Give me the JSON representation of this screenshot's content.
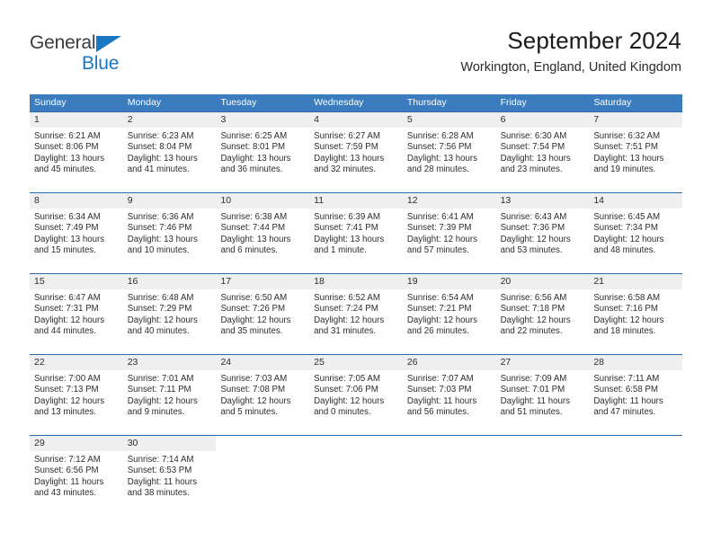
{
  "brand": {
    "name_part1": "General",
    "name_part2": "Blue",
    "accent_color": "#1878c4",
    "text_color": "#3b3b3b"
  },
  "header": {
    "title": "September 2024",
    "subtitle": "Workington, England, United Kingdom"
  },
  "calendar": {
    "header_bg": "#3a7cbe",
    "row_border": "#2d6ca8",
    "daynum_bg": "#efefef",
    "weekdays": [
      "Sunday",
      "Monday",
      "Tuesday",
      "Wednesday",
      "Thursday",
      "Friday",
      "Saturday"
    ],
    "weeks": [
      [
        {
          "day": "1",
          "sunrise": "Sunrise: 6:21 AM",
          "sunset": "Sunset: 8:06 PM",
          "daylight1": "Daylight: 13 hours",
          "daylight2": "and 45 minutes."
        },
        {
          "day": "2",
          "sunrise": "Sunrise: 6:23 AM",
          "sunset": "Sunset: 8:04 PM",
          "daylight1": "Daylight: 13 hours",
          "daylight2": "and 41 minutes."
        },
        {
          "day": "3",
          "sunrise": "Sunrise: 6:25 AM",
          "sunset": "Sunset: 8:01 PM",
          "daylight1": "Daylight: 13 hours",
          "daylight2": "and 36 minutes."
        },
        {
          "day": "4",
          "sunrise": "Sunrise: 6:27 AM",
          "sunset": "Sunset: 7:59 PM",
          "daylight1": "Daylight: 13 hours",
          "daylight2": "and 32 minutes."
        },
        {
          "day": "5",
          "sunrise": "Sunrise: 6:28 AM",
          "sunset": "Sunset: 7:56 PM",
          "daylight1": "Daylight: 13 hours",
          "daylight2": "and 28 minutes."
        },
        {
          "day": "6",
          "sunrise": "Sunrise: 6:30 AM",
          "sunset": "Sunset: 7:54 PM",
          "daylight1": "Daylight: 13 hours",
          "daylight2": "and 23 minutes."
        },
        {
          "day": "7",
          "sunrise": "Sunrise: 6:32 AM",
          "sunset": "Sunset: 7:51 PM",
          "daylight1": "Daylight: 13 hours",
          "daylight2": "and 19 minutes."
        }
      ],
      [
        {
          "day": "8",
          "sunrise": "Sunrise: 6:34 AM",
          "sunset": "Sunset: 7:49 PM",
          "daylight1": "Daylight: 13 hours",
          "daylight2": "and 15 minutes."
        },
        {
          "day": "9",
          "sunrise": "Sunrise: 6:36 AM",
          "sunset": "Sunset: 7:46 PM",
          "daylight1": "Daylight: 13 hours",
          "daylight2": "and 10 minutes."
        },
        {
          "day": "10",
          "sunrise": "Sunrise: 6:38 AM",
          "sunset": "Sunset: 7:44 PM",
          "daylight1": "Daylight: 13 hours",
          "daylight2": "and 6 minutes."
        },
        {
          "day": "11",
          "sunrise": "Sunrise: 6:39 AM",
          "sunset": "Sunset: 7:41 PM",
          "daylight1": "Daylight: 13 hours",
          "daylight2": "and 1 minute."
        },
        {
          "day": "12",
          "sunrise": "Sunrise: 6:41 AM",
          "sunset": "Sunset: 7:39 PM",
          "daylight1": "Daylight: 12 hours",
          "daylight2": "and 57 minutes."
        },
        {
          "day": "13",
          "sunrise": "Sunrise: 6:43 AM",
          "sunset": "Sunset: 7:36 PM",
          "daylight1": "Daylight: 12 hours",
          "daylight2": "and 53 minutes."
        },
        {
          "day": "14",
          "sunrise": "Sunrise: 6:45 AM",
          "sunset": "Sunset: 7:34 PM",
          "daylight1": "Daylight: 12 hours",
          "daylight2": "and 48 minutes."
        }
      ],
      [
        {
          "day": "15",
          "sunrise": "Sunrise: 6:47 AM",
          "sunset": "Sunset: 7:31 PM",
          "daylight1": "Daylight: 12 hours",
          "daylight2": "and 44 minutes."
        },
        {
          "day": "16",
          "sunrise": "Sunrise: 6:48 AM",
          "sunset": "Sunset: 7:29 PM",
          "daylight1": "Daylight: 12 hours",
          "daylight2": "and 40 minutes."
        },
        {
          "day": "17",
          "sunrise": "Sunrise: 6:50 AM",
          "sunset": "Sunset: 7:26 PM",
          "daylight1": "Daylight: 12 hours",
          "daylight2": "and 35 minutes."
        },
        {
          "day": "18",
          "sunrise": "Sunrise: 6:52 AM",
          "sunset": "Sunset: 7:24 PM",
          "daylight1": "Daylight: 12 hours",
          "daylight2": "and 31 minutes."
        },
        {
          "day": "19",
          "sunrise": "Sunrise: 6:54 AM",
          "sunset": "Sunset: 7:21 PM",
          "daylight1": "Daylight: 12 hours",
          "daylight2": "and 26 minutes."
        },
        {
          "day": "20",
          "sunrise": "Sunrise: 6:56 AM",
          "sunset": "Sunset: 7:18 PM",
          "daylight1": "Daylight: 12 hours",
          "daylight2": "and 22 minutes."
        },
        {
          "day": "21",
          "sunrise": "Sunrise: 6:58 AM",
          "sunset": "Sunset: 7:16 PM",
          "daylight1": "Daylight: 12 hours",
          "daylight2": "and 18 minutes."
        }
      ],
      [
        {
          "day": "22",
          "sunrise": "Sunrise: 7:00 AM",
          "sunset": "Sunset: 7:13 PM",
          "daylight1": "Daylight: 12 hours",
          "daylight2": "and 13 minutes."
        },
        {
          "day": "23",
          "sunrise": "Sunrise: 7:01 AM",
          "sunset": "Sunset: 7:11 PM",
          "daylight1": "Daylight: 12 hours",
          "daylight2": "and 9 minutes."
        },
        {
          "day": "24",
          "sunrise": "Sunrise: 7:03 AM",
          "sunset": "Sunset: 7:08 PM",
          "daylight1": "Daylight: 12 hours",
          "daylight2": "and 5 minutes."
        },
        {
          "day": "25",
          "sunrise": "Sunrise: 7:05 AM",
          "sunset": "Sunset: 7:06 PM",
          "daylight1": "Daylight: 12 hours",
          "daylight2": "and 0 minutes."
        },
        {
          "day": "26",
          "sunrise": "Sunrise: 7:07 AM",
          "sunset": "Sunset: 7:03 PM",
          "daylight1": "Daylight: 11 hours",
          "daylight2": "and 56 minutes."
        },
        {
          "day": "27",
          "sunrise": "Sunrise: 7:09 AM",
          "sunset": "Sunset: 7:01 PM",
          "daylight1": "Daylight: 11 hours",
          "daylight2": "and 51 minutes."
        },
        {
          "day": "28",
          "sunrise": "Sunrise: 7:11 AM",
          "sunset": "Sunset: 6:58 PM",
          "daylight1": "Daylight: 11 hours",
          "daylight2": "and 47 minutes."
        }
      ],
      [
        {
          "day": "29",
          "sunrise": "Sunrise: 7:12 AM",
          "sunset": "Sunset: 6:56 PM",
          "daylight1": "Daylight: 11 hours",
          "daylight2": "and 43 minutes."
        },
        {
          "day": "30",
          "sunrise": "Sunrise: 7:14 AM",
          "sunset": "Sunset: 6:53 PM",
          "daylight1": "Daylight: 11 hours",
          "daylight2": "and 38 minutes."
        },
        {
          "day": "",
          "sunrise": "",
          "sunset": "",
          "daylight1": "",
          "daylight2": ""
        },
        {
          "day": "",
          "sunrise": "",
          "sunset": "",
          "daylight1": "",
          "daylight2": ""
        },
        {
          "day": "",
          "sunrise": "",
          "sunset": "",
          "daylight1": "",
          "daylight2": ""
        },
        {
          "day": "",
          "sunrise": "",
          "sunset": "",
          "daylight1": "",
          "daylight2": ""
        },
        {
          "day": "",
          "sunrise": "",
          "sunset": "",
          "daylight1": "",
          "daylight2": ""
        }
      ]
    ]
  }
}
